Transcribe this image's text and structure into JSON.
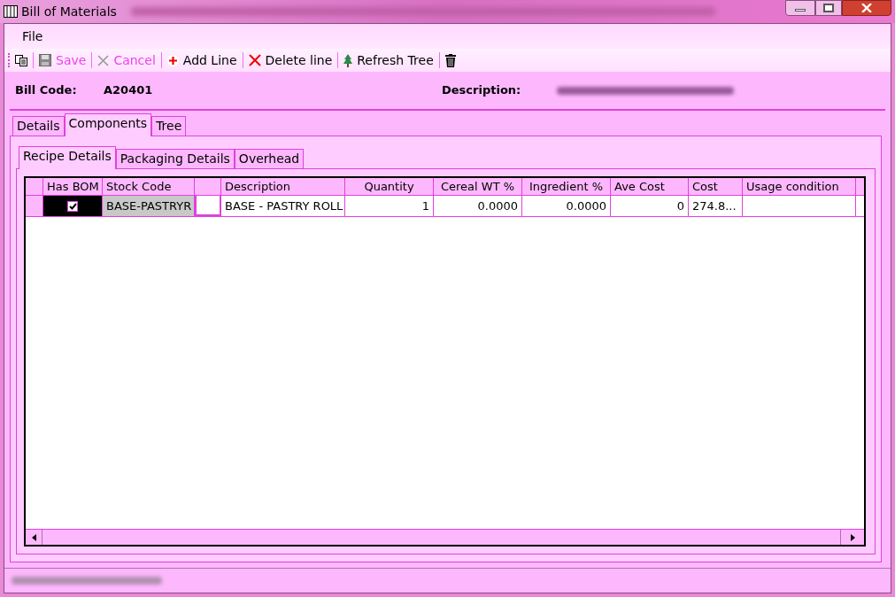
{
  "window": {
    "title": "Bill of Materials"
  },
  "menu": [
    "File"
  ],
  "toolbar": [
    {
      "kind": "copy",
      "disabled": false
    },
    {
      "kind": "save",
      "label": "Save",
      "disabled": true
    },
    {
      "kind": "cancel",
      "label": "Cancel",
      "disabled": true
    },
    {
      "kind": "add",
      "label": "Add Line",
      "disabled": false
    },
    {
      "kind": "delete",
      "label": "Delete line",
      "disabled": false
    },
    {
      "kind": "tree",
      "label": "Refresh Tree",
      "disabled": false
    },
    {
      "kind": "trash",
      "disabled": false
    }
  ],
  "header": {
    "bill_code_label": "Bill Code:",
    "bill_code": "A20401",
    "description_label": "Description:"
  },
  "tabs": [
    {
      "label": "Details",
      "selected": false
    },
    {
      "label": "Components",
      "selected": true
    },
    {
      "label": "Tree",
      "selected": false
    }
  ],
  "subtabs": [
    {
      "label": "Recipe Details",
      "selected": true
    },
    {
      "label": "Packaging Details",
      "selected": false
    },
    {
      "label": "Overhead",
      "selected": false
    }
  ],
  "table": {
    "columns": [
      {
        "label": "Has BOM"
      },
      {
        "label": "Stock Code"
      },
      {},
      {
        "label": "Description"
      },
      {
        "label": "Quantity"
      },
      {
        "label": "Cereal WT %"
      },
      {
        "label": "Ingredient %"
      },
      {
        "label": "Ave Cost"
      },
      {
        "label": "Cost"
      },
      {
        "label": "Usage condition"
      }
    ],
    "rows": [
      {
        "has_bom": true,
        "stock_code": "BASE-PASTRYR",
        "description": "BASE - PASTRY ROLL",
        "quantity": "1",
        "cereal_wt": "0.0000",
        "ingredient": "0.0000",
        "ave_cost": "0",
        "cost": "274.8..."
      }
    ]
  }
}
